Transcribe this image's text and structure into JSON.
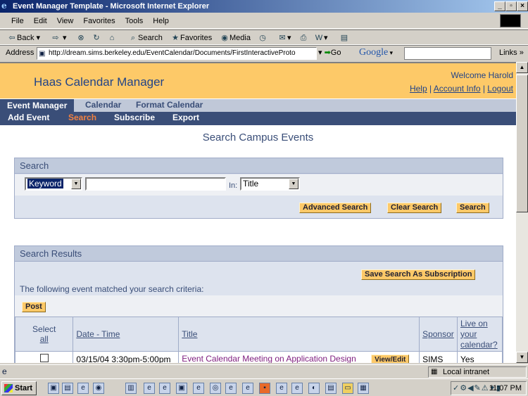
{
  "window": {
    "title": "Event Manager Template - Microsoft Internet Explorer"
  },
  "menu": [
    "File",
    "Edit",
    "View",
    "Favorites",
    "Tools",
    "Help"
  ],
  "toolbar": {
    "back": "Back",
    "search": "Search",
    "favorites": "Favorites",
    "media": "Media"
  },
  "address": {
    "label": "Address",
    "url": "http://dream.sims.berkeley.edu/EventCalendar/Documents/FirstInteractiveProto",
    "go": "Go",
    "google": "Google",
    "links": "Links"
  },
  "header": {
    "app_title": "Haas Calendar Manager",
    "welcome": "Welcome Harold",
    "links": {
      "help": "Help",
      "account": "Account Info",
      "logout": "Logout"
    }
  },
  "nav_primary": [
    "Event Manager",
    "Calendar",
    "Format Calendar"
  ],
  "nav_secondary": [
    "Add Event",
    "Search",
    "Subscribe",
    "Export"
  ],
  "page_title": "Search Campus Events",
  "search_panel": {
    "title": "Search",
    "field_select": "Keyword",
    "query": "",
    "in_label": "In:",
    "in_select": "Title",
    "buttons": {
      "advanced": "Advanced Search",
      "clear": "Clear Search",
      "search": "Search"
    }
  },
  "results_panel": {
    "title": "Search Results",
    "save_button": "Save Search As Subscription",
    "message": "The following event matched your search criteria:",
    "post_button": "Post",
    "columns": {
      "select": "Select",
      "select_all": "all",
      "datetime": "Date - Time",
      "title": "Title",
      "sponsor": "Sponsor",
      "live": "Live on your calendar?"
    },
    "rows": [
      {
        "datetime": "03/15/04 3:30pm-5:00pm",
        "title": "Event Calendar Meeting on Application Design",
        "action": "View/Edit",
        "sponsor": "SIMS",
        "live": "Yes"
      }
    ]
  },
  "status": {
    "zone": "Local intranet"
  },
  "taskbar": {
    "start": "Start",
    "clock": "11:07 PM"
  }
}
